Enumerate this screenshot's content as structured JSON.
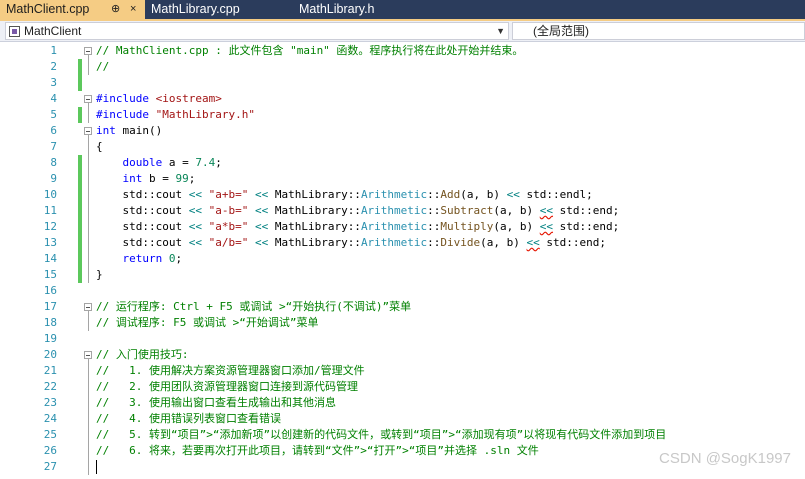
{
  "tabs": [
    {
      "label": "MathClient.cpp",
      "pin": "⊕",
      "close": "×",
      "active": true
    },
    {
      "label": "MathLibrary.cpp",
      "active": false
    },
    {
      "label": "MathLibrary.h",
      "active": false
    }
  ],
  "navbar": {
    "project": "MathClient",
    "scope": "(全局范围)"
  },
  "colors": {
    "tab_active": "#f5cc84",
    "tabbar_bg": "#2b3c5c",
    "line_number": "#2b91af",
    "change_bar": "#5cc85c",
    "comment": "#008000",
    "keyword": "#0000ff",
    "string": "#a31515"
  },
  "lines": [
    {
      "n": "1",
      "tokens": [
        [
          "com",
          "// MathClient.cpp : 此文件包含 \"main\" 函数。程序执行将在此处开始并结束。"
        ]
      ]
    },
    {
      "n": "2",
      "tokens": [
        [
          "com",
          "//"
        ]
      ]
    },
    {
      "n": "3",
      "tokens": []
    },
    {
      "n": "4",
      "tokens": [
        [
          "kw",
          "#include"
        ],
        [
          "",
          " "
        ],
        [
          "str",
          "<iostream>"
        ]
      ]
    },
    {
      "n": "5",
      "tokens": [
        [
          "kw",
          "#include"
        ],
        [
          "",
          " "
        ],
        [
          "str",
          "\"MathLibrary.h\""
        ]
      ]
    },
    {
      "n": "6",
      "tokens": [
        [
          "kw",
          "int"
        ],
        [
          "",
          " main()"
        ]
      ]
    },
    {
      "n": "7",
      "tokens": [
        [
          "",
          "{"
        ]
      ]
    },
    {
      "n": "8",
      "tokens": [
        [
          "",
          "    "
        ],
        [
          "kw",
          "double"
        ],
        [
          "",
          " a = "
        ],
        [
          "num",
          "7.4"
        ],
        [
          "",
          ";"
        ]
      ]
    },
    {
      "n": "9",
      "tokens": [
        [
          "",
          "    "
        ],
        [
          "kw",
          "int"
        ],
        [
          "",
          " b = "
        ],
        [
          "num",
          "99"
        ],
        [
          "",
          ";"
        ]
      ]
    },
    {
      "n": "10",
      "tokens": [
        [
          "",
          "    std::cout "
        ],
        [
          "op",
          "<<"
        ],
        [
          "",
          " "
        ],
        [
          "str",
          "\"a+b=\""
        ],
        [
          "",
          " "
        ],
        [
          "op",
          "<<"
        ],
        [
          "",
          " MathLibrary::"
        ],
        [
          "ns",
          "Arithmetic"
        ],
        [
          "",
          "::"
        ],
        [
          "fn",
          "Add"
        ],
        [
          "",
          "(a, b) "
        ],
        [
          "op",
          "<<"
        ],
        [
          "",
          " std::endl;"
        ]
      ]
    },
    {
      "n": "11",
      "tokens": [
        [
          "",
          "    std::cout "
        ],
        [
          "op",
          "<<"
        ],
        [
          "",
          " "
        ],
        [
          "str",
          "\"a-b=\""
        ],
        [
          "",
          " "
        ],
        [
          "op",
          "<<"
        ],
        [
          "",
          " MathLibrary::"
        ],
        [
          "ns",
          "Arithmetic"
        ],
        [
          "",
          "::"
        ],
        [
          "fn",
          "Subtract"
        ],
        [
          "",
          "(a, b) "
        ],
        [
          "sq",
          "<<"
        ],
        [
          "",
          " std::end;"
        ]
      ]
    },
    {
      "n": "12",
      "tokens": [
        [
          "",
          "    std::cout "
        ],
        [
          "op",
          "<<"
        ],
        [
          "",
          " "
        ],
        [
          "str",
          "\"a*b=\""
        ],
        [
          "",
          " "
        ],
        [
          "op",
          "<<"
        ],
        [
          "",
          " MathLibrary::"
        ],
        [
          "ns",
          "Arithmetic"
        ],
        [
          "",
          "::"
        ],
        [
          "fn",
          "Multiply"
        ],
        [
          "",
          "(a, b) "
        ],
        [
          "sq",
          "<<"
        ],
        [
          "",
          " std::end;"
        ]
      ]
    },
    {
      "n": "13",
      "tokens": [
        [
          "",
          "    std::cout "
        ],
        [
          "op",
          "<<"
        ],
        [
          "",
          " "
        ],
        [
          "str",
          "\"a/b=\""
        ],
        [
          "",
          " "
        ],
        [
          "op",
          "<<"
        ],
        [
          "",
          " MathLibrary::"
        ],
        [
          "ns",
          "Arithmetic"
        ],
        [
          "",
          "::"
        ],
        [
          "fn",
          "Divide"
        ],
        [
          "",
          "(a, b) "
        ],
        [
          "sq",
          "<<"
        ],
        [
          "",
          " std::end;"
        ]
      ]
    },
    {
      "n": "14",
      "tokens": [
        [
          "",
          "    "
        ],
        [
          "kw",
          "return"
        ],
        [
          "",
          " "
        ],
        [
          "num",
          "0"
        ],
        [
          "",
          ";"
        ]
      ]
    },
    {
      "n": "15",
      "tokens": [
        [
          "",
          "}"
        ]
      ]
    },
    {
      "n": "16",
      "tokens": []
    },
    {
      "n": "17",
      "tokens": [
        [
          "com",
          "// 运行程序: Ctrl + F5 或调试 >“开始执行(不调试)”菜单"
        ]
      ]
    },
    {
      "n": "18",
      "tokens": [
        [
          "com",
          "// 调试程序: F5 或调试 >“开始调试”菜单"
        ]
      ]
    },
    {
      "n": "19",
      "tokens": []
    },
    {
      "n": "20",
      "tokens": [
        [
          "com",
          "// 入门使用技巧:"
        ]
      ]
    },
    {
      "n": "21",
      "tokens": [
        [
          "com",
          "//   1. 使用解决方案资源管理器窗口添加/管理文件"
        ]
      ]
    },
    {
      "n": "22",
      "tokens": [
        [
          "com",
          "//   2. 使用团队资源管理器窗口连接到源代码管理"
        ]
      ]
    },
    {
      "n": "23",
      "tokens": [
        [
          "com",
          "//   3. 使用输出窗口查看生成输出和其他消息"
        ]
      ]
    },
    {
      "n": "24",
      "tokens": [
        [
          "com",
          "//   4. 使用错误列表窗口查看错误"
        ]
      ]
    },
    {
      "n": "25",
      "tokens": [
        [
          "com",
          "//   5. 转到“项目”>“添加新项”以创建新的代码文件，或转到“项目”>“添加现有项”以将现有代码文件添加到项目"
        ]
      ]
    },
    {
      "n": "26",
      "tokens": [
        [
          "com",
          "//   6. 将来，若要再次打开此项目，请转到“文件”>“打开”>“项目”并选择 .sln 文件"
        ]
      ]
    },
    {
      "n": "27",
      "tokens": []
    }
  ],
  "watermark": "CSDN @SogK1997"
}
